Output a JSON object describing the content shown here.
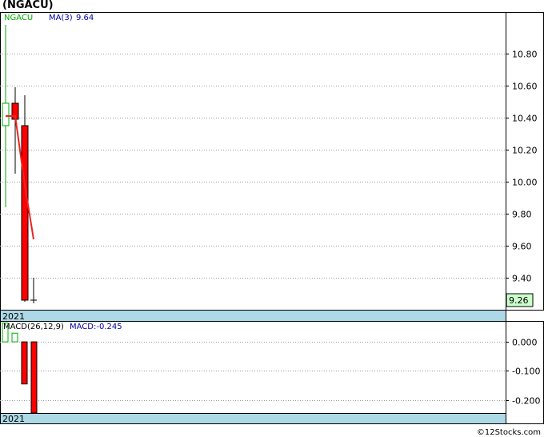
{
  "title": "(NGACU)",
  "footer": "©12Stocks.com",
  "colors": {
    "up": "#00AA00",
    "down": "#FF0000",
    "ma": "#EE2222",
    "year_bar": "#ADD8E6",
    "price_label_bg": "#CCFFCC",
    "macd_label": "#0000AA",
    "grid": "#999999"
  },
  "chart_data": [
    {
      "type": "candlestick",
      "legend": {
        "symbol": "NGACU",
        "ma_label": "MA(3)",
        "ma_value": "9.64"
      },
      "candles": [
        {
          "open": 10.35,
          "high": 10.98,
          "low": 9.84,
          "close": 10.49
        },
        {
          "open": 10.49,
          "high": 10.59,
          "low": 10.05,
          "close": 10.39
        },
        {
          "open": 10.35,
          "high": 10.54,
          "low": 9.25,
          "close": 9.26
        },
        {
          "open": 9.26,
          "high": 9.4,
          "low": 9.24,
          "close": 9.26
        }
      ],
      "ma": [
        {
          "index": 0,
          "value": 10.41
        },
        {
          "index": 1,
          "value": 10.41
        },
        {
          "index": 2,
          "value": 9.98
        },
        {
          "index": 3,
          "value": 9.64
        }
      ],
      "y_ticks": [
        "10.80",
        "10.60",
        "10.40",
        "10.20",
        "10.00",
        "9.80",
        "9.60",
        "9.40"
      ],
      "ylim": [
        9.2,
        11.06
      ],
      "last_price": "9.26",
      "x_label": "2021",
      "grid": true
    },
    {
      "type": "bar",
      "legend": {
        "label": "MACD(26,12,9)",
        "value_label": "MACD:-0.245"
      },
      "values": [
        0.065,
        0.03,
        -0.145,
        -0.245
      ],
      "y_ticks": [
        "0.000",
        "-0.100",
        "-0.200"
      ],
      "ylim": [
        -0.245,
        0.072
      ],
      "x_label": "2021",
      "grid": true
    }
  ]
}
